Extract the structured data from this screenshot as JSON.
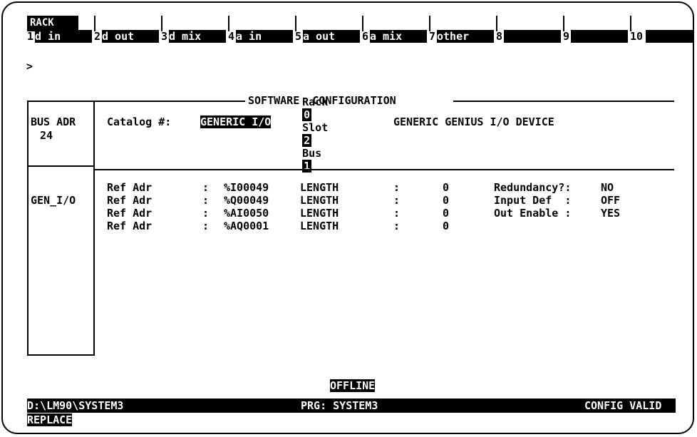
{
  "rack_label": "RACK",
  "softkeys": [
    {
      "num": "1",
      "label": "d in"
    },
    {
      "num": "2",
      "label": "d out"
    },
    {
      "num": "3",
      "label": "d mix"
    },
    {
      "num": "4",
      "label": "a in"
    },
    {
      "num": "5",
      "label": "a out"
    },
    {
      "num": "6",
      "label": "a mix"
    },
    {
      "num": "7",
      "label": "other"
    },
    {
      "num": "8",
      "label": ""
    },
    {
      "num": "9",
      "label": ""
    },
    {
      "num": "10",
      "label": ""
    }
  ],
  "prompt": ">",
  "location": {
    "rack_label": "Rack",
    "rack": "0",
    "slot_label": "Slot",
    "slot": "2",
    "bus_label": "Bus",
    "bus": "1"
  },
  "section_title": "SOFTWARE  CONFIGURATION",
  "left_panel": {
    "bus_adr_label": "BUS ADR",
    "bus_adr": "24",
    "device_type": "GEN_I/O"
  },
  "catalog": {
    "label": "Catalog #:",
    "value": "GENERIC I/O",
    "description": "GENERIC GENIUS I/O DEVICE"
  },
  "refs": [
    {
      "label": "Ref Adr",
      "sep": ":",
      "addr": "%I00049",
      "len_label": "LENGTH",
      "len_sep": ":",
      "len": "0"
    },
    {
      "label": "Ref Adr",
      "sep": ":",
      "addr": "%Q00049",
      "len_label": "LENGTH",
      "len_sep": ":",
      "len": "0"
    },
    {
      "label": "Ref Adr",
      "sep": ":",
      "addr": "%AI0050",
      "len_label": "LENGTH",
      "len_sep": ":",
      "len": "0"
    },
    {
      "label": "Ref Adr",
      "sep": ":",
      "addr": "%AQ0001",
      "len_label": "LENGTH",
      "len_sep": ":",
      "len": "0"
    }
  ],
  "options": [
    {
      "label": "Redundancy?:",
      "value": "NO"
    },
    {
      "label": "Input Def  :",
      "value": "OFF"
    },
    {
      "label": "Out Enable :",
      "value": "YES"
    }
  ],
  "status": {
    "mode": "OFFLINE",
    "path": "D:\\LM90\\SYSTEM3",
    "program": "PRG: SYSTEM3",
    "config": "CONFIG VALID",
    "edit_mode": "REPLACE"
  }
}
